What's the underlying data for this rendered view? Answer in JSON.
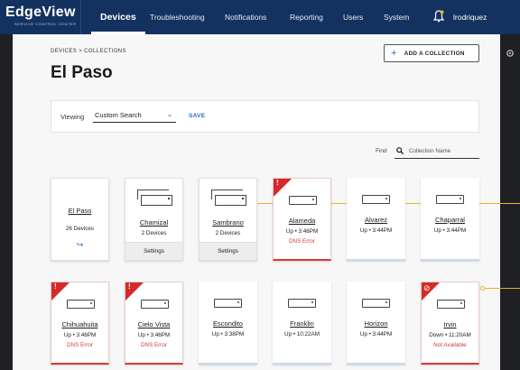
{
  "brand": {
    "name": "EdgeView",
    "tagline": "SERVICE CONTROL CENTER"
  },
  "nav": {
    "tabs": [
      "Devices",
      "Troubleshooting",
      "Notifications",
      "Reporting",
      "Users",
      "System"
    ],
    "active": "Devices",
    "user": "lrodriquez"
  },
  "breadcrumb": "DEVICES  >  COLLECTIONS",
  "page_title": "El Paso",
  "add_button": {
    "icon": "plus-icon",
    "label": "ADD A COLLECTION"
  },
  "viewing": {
    "label": "Viewing",
    "selected": "Custom Search",
    "save_label": "SAVE"
  },
  "find": {
    "label": "Find",
    "placeholder": "Collection Name"
  },
  "colors": {
    "brand_nav": "#14325f",
    "accent": "#1f6fd6",
    "error": "#d63a3a",
    "connector": "#e8b428"
  },
  "parent_card": {
    "name": "El Paso",
    "count": "26 Devices",
    "icon": "return-arrow-icon"
  },
  "groups": [
    {
      "name": "Chamizal",
      "count": "2 Devices",
      "action": "Settings"
    },
    {
      "name": "Sambrano",
      "count": "2 Devices",
      "action": "Settings"
    }
  ],
  "devices": [
    {
      "name": "Alameda",
      "status": "Up • 3:46PM",
      "error": "DNS Error",
      "flag": "!"
    },
    {
      "name": "Alvarez",
      "status": "Up • 3:44PM"
    },
    {
      "name": "Chaparral",
      "status": "Up • 3:44PM"
    },
    {
      "name": "Chihuahuita",
      "status": "Up • 3:46PM",
      "error": "DNS Error",
      "flag": "!"
    },
    {
      "name": "Cielo Vista",
      "status": "Up • 3:46PM",
      "error": "DNS Error",
      "flag": "!"
    },
    {
      "name": "Escondito",
      "status": "Up • 3:38PM"
    },
    {
      "name": "Franklin",
      "status": "Up • 10:22AM"
    },
    {
      "name": "Horizon",
      "status": "Up • 3:44PM"
    },
    {
      "name": "Irvin",
      "status": "Down • 11:20AM",
      "error": "Not Available",
      "flag": "⊘"
    }
  ]
}
